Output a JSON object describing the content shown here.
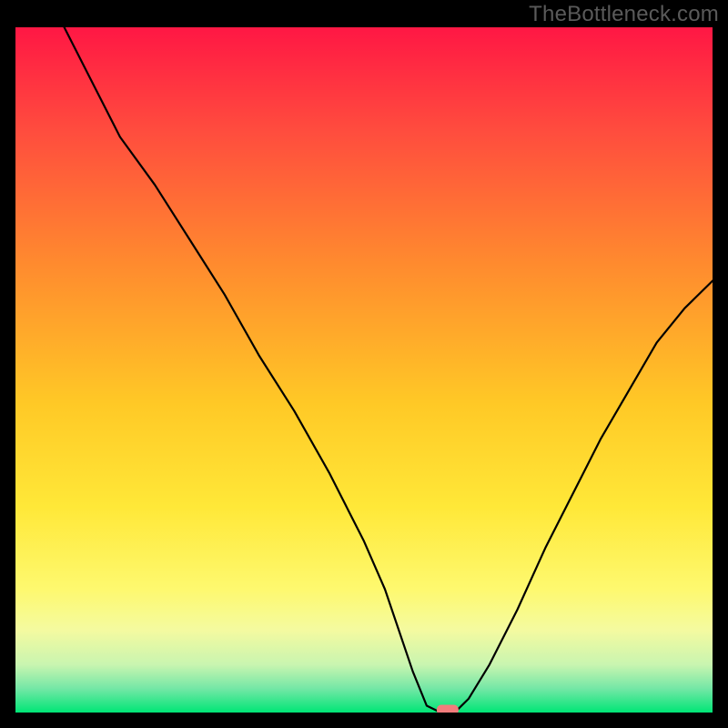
{
  "watermark": {
    "text": "TheBottleneck.com"
  },
  "chart_data": {
    "type": "line",
    "title": "",
    "xlabel": "",
    "ylabel": "",
    "xlim": [
      0,
      100
    ],
    "ylim": [
      0,
      100
    ],
    "series": [
      {
        "name": "bottleneck-curve",
        "x": [
          7,
          10,
          15,
          20,
          25,
          30,
          35,
          40,
          45,
          50,
          53,
          55,
          57,
          59,
          61,
          63,
          65,
          68,
          72,
          76,
          80,
          84,
          88,
          92,
          96,
          100
        ],
        "y": [
          100,
          94,
          84,
          77,
          69,
          61,
          52,
          44,
          35,
          25,
          18,
          12,
          6,
          1,
          0,
          0,
          2,
          7,
          15,
          24,
          32,
          40,
          47,
          54,
          59,
          63
        ]
      }
    ],
    "marker": {
      "x": 62,
      "y": 0.4,
      "color": "#F27C7C"
    },
    "gradient_stops": [
      {
        "offset": 0.0,
        "color": "#FF1744"
      },
      {
        "offset": 0.15,
        "color": "#FF4C3E"
      },
      {
        "offset": 0.35,
        "color": "#FF8C2E"
      },
      {
        "offset": 0.55,
        "color": "#FFC926"
      },
      {
        "offset": 0.7,
        "color": "#FFE838"
      },
      {
        "offset": 0.82,
        "color": "#FEF96F"
      },
      {
        "offset": 0.88,
        "color": "#F4FAA0"
      },
      {
        "offset": 0.93,
        "color": "#C9F5B0"
      },
      {
        "offset": 0.965,
        "color": "#74E7A6"
      },
      {
        "offset": 1.0,
        "color": "#00E676"
      }
    ]
  }
}
